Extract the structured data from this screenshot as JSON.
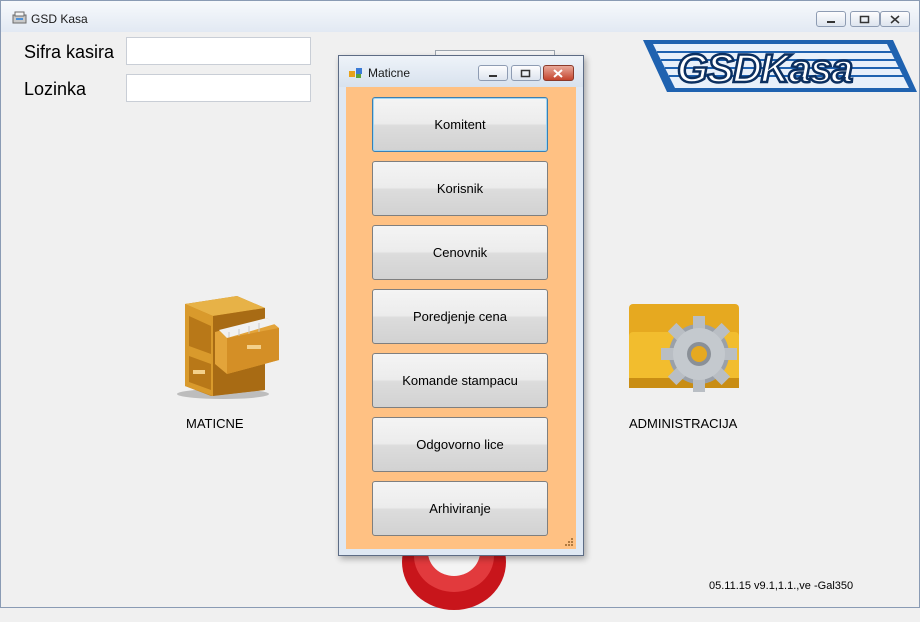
{
  "window": {
    "title": "GSD Kasa"
  },
  "login": {
    "cashier_label": "Sifra kasira",
    "cashier_value": "",
    "password_label": "Lozinka",
    "password_value": ""
  },
  "logo": {
    "text": "GSDKasa",
    "color": "#1a5ca8"
  },
  "modules": {
    "maticne_label": "MATICNE",
    "admin_label": "ADMINISTRACIJA"
  },
  "version": "05.11.15 v9.1,1.1.,ve -Gal350",
  "dialog": {
    "title": "Maticne",
    "background": "#ffc183",
    "buttons": [
      {
        "label": "Komitent"
      },
      {
        "label": "Korisnik"
      },
      {
        "label": "Cenovnik"
      },
      {
        "label": "Poredjenje cena"
      },
      {
        "label": "Komande stampacu"
      },
      {
        "label": "Odgovorno lice"
      },
      {
        "label": "Arhiviranje"
      }
    ]
  }
}
